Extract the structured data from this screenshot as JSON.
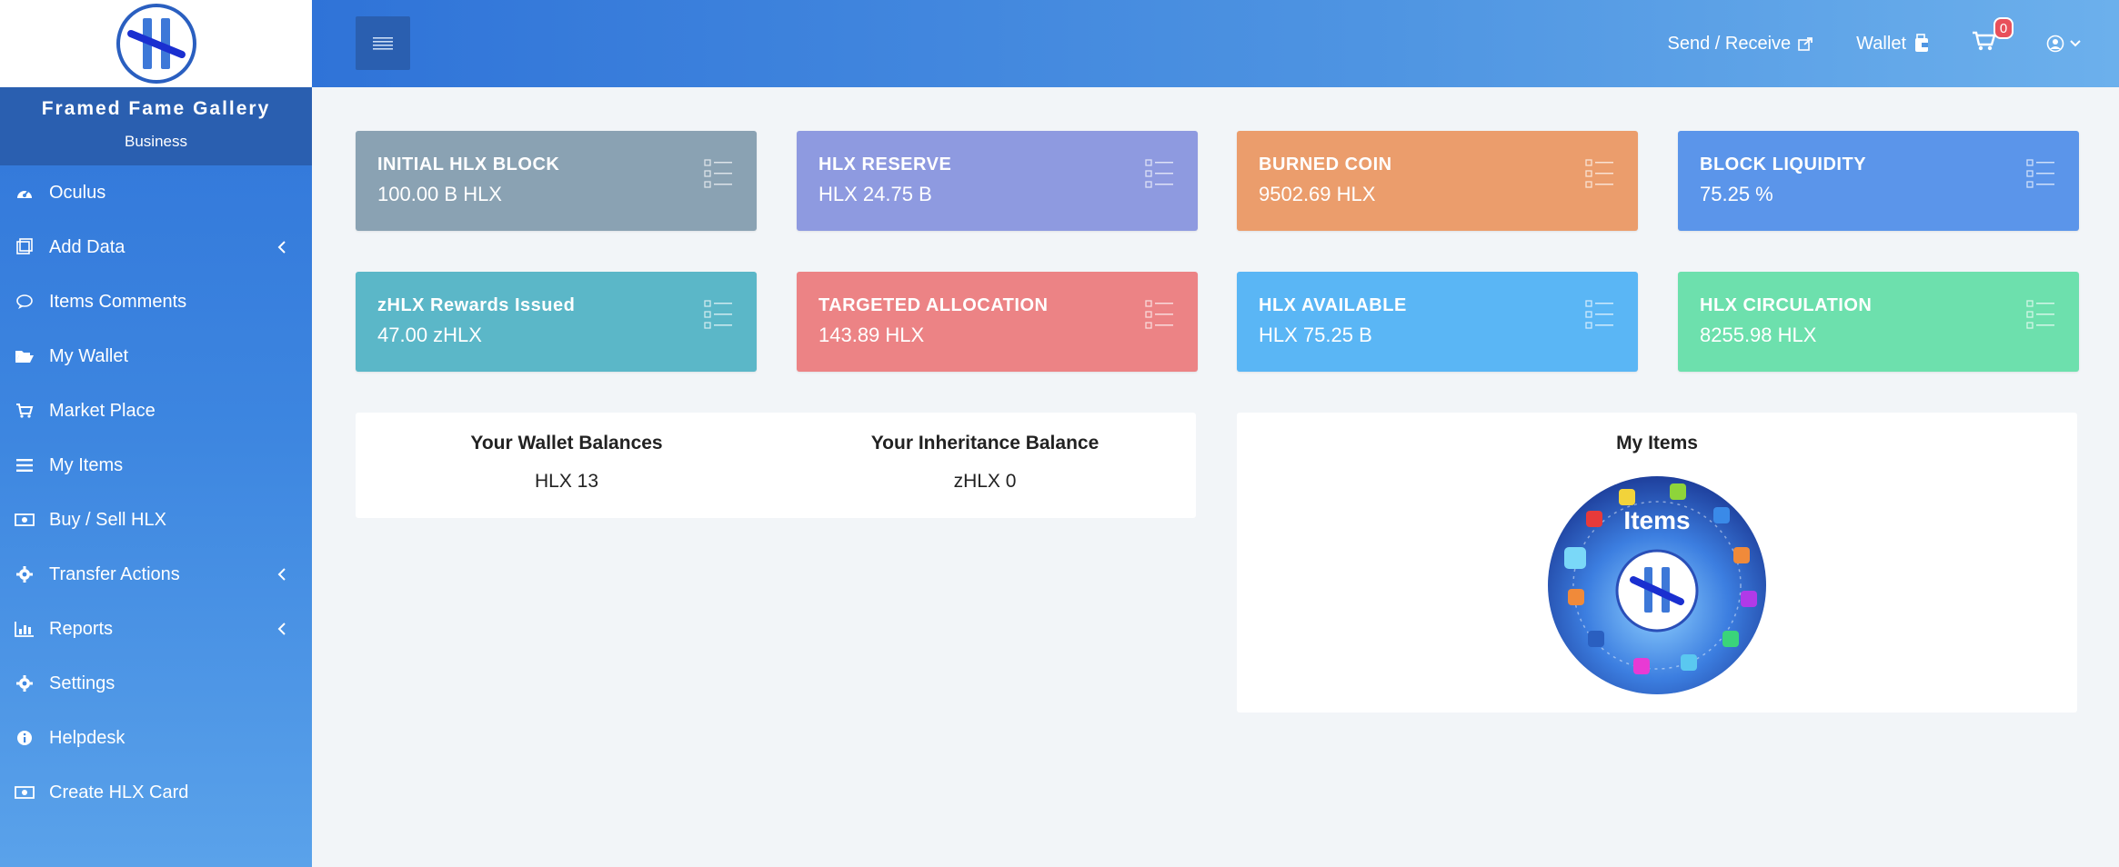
{
  "brand": {
    "name": "Framed Fame Gallery",
    "subtitle": "Business"
  },
  "sidebar": {
    "items": [
      {
        "label": "Oculus",
        "icon": "dashboard-icon",
        "has_submenu": false
      },
      {
        "label": "Add Data",
        "icon": "add-data-icon",
        "has_submenu": true
      },
      {
        "label": "Items Comments",
        "icon": "comment-icon",
        "has_submenu": false
      },
      {
        "label": "My Wallet",
        "icon": "folder-open-icon",
        "has_submenu": false
      },
      {
        "label": "Market Place",
        "icon": "cart-icon",
        "has_submenu": false
      },
      {
        "label": "My Items",
        "icon": "list-icon",
        "has_submenu": false
      },
      {
        "label": "Buy / Sell HLX",
        "icon": "money-icon",
        "has_submenu": false
      },
      {
        "label": "Transfer Actions",
        "icon": "gear-icon",
        "has_submenu": true
      },
      {
        "label": "Reports",
        "icon": "bar-chart-icon",
        "has_submenu": true
      },
      {
        "label": "Settings",
        "icon": "gear-icon",
        "has_submenu": false
      },
      {
        "label": "Helpdesk",
        "icon": "info-icon",
        "has_submenu": false
      },
      {
        "label": "Create HLX Card",
        "icon": "money-icon",
        "has_submenu": false
      }
    ]
  },
  "header": {
    "send_receive": "Send / Receive",
    "wallet": "Wallet",
    "cart_count": "0"
  },
  "stats": [
    {
      "title": "INITIAL HLX BLOCK",
      "value": "100.00 B HLX",
      "color": "#8aa2b3"
    },
    {
      "title": "HLX RESERVE",
      "value": "HLX 24.75 B",
      "color": "#8e9ae0"
    },
    {
      "title": "BURNED COIN",
      "value": "9502.69 HLX",
      "color": "#eb9d6c"
    },
    {
      "title": "BLOCK LIQUIDITY",
      "value": "75.25 %",
      "color": "#5b95ea"
    },
    {
      "title": "zHLX Rewards Issued",
      "value": "47.00 zHLX",
      "color": "#5bb7c8"
    },
    {
      "title": "TARGETED ALLOCATION",
      "value": "143.89 HLX",
      "color": "#ec8385"
    },
    {
      "title": "HLX AVAILABLE",
      "value": "HLX 75.25 B",
      "color": "#5ab6f5"
    },
    {
      "title": "HLX CIRCULATION",
      "value": "8255.98 HLX",
      "color": "#6de0ad"
    }
  ],
  "balances": {
    "wallet_title": "Your Wallet Balances",
    "wallet_value": "HLX 13",
    "inheritance_title": "Your Inheritance Balance",
    "inheritance_value": "zHLX 0"
  },
  "my_items": {
    "title": "My Items",
    "image_label": "Items"
  }
}
